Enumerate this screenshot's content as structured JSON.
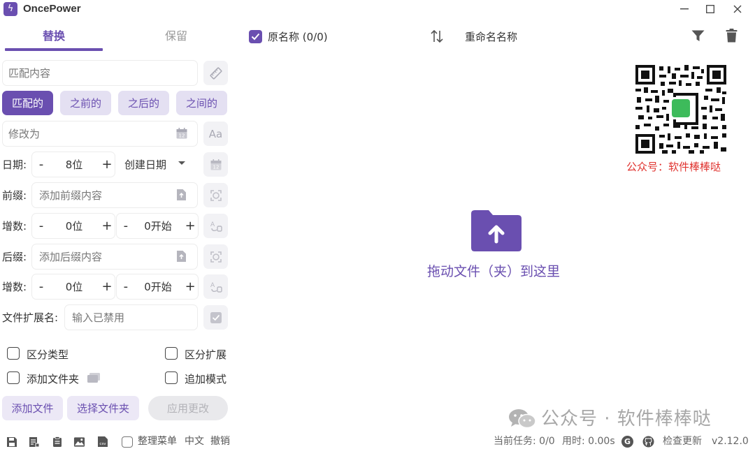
{
  "app": {
    "title": "OncePower",
    "logo_glyph": "ϟ"
  },
  "window_controls": {
    "minimize": "–",
    "maximize": "□",
    "close": "✕"
  },
  "tabs": [
    {
      "label": "替换",
      "active": true
    },
    {
      "label": "保留",
      "active": false
    }
  ],
  "match": {
    "placeholder": "匹配内容"
  },
  "modes": [
    {
      "label": "匹配的",
      "active": true
    },
    {
      "label": "之前的",
      "active": false
    },
    {
      "label": "之后的",
      "active": false
    },
    {
      "label": "之间的",
      "active": false
    }
  ],
  "modify": {
    "placeholder": "修改为",
    "case_button": "Aa"
  },
  "date": {
    "label": "日期:",
    "minus": "-",
    "plus": "+",
    "digits": "8位",
    "type": "创建日期"
  },
  "prefix": {
    "label": "前缀:",
    "placeholder": "添加前缀内容",
    "increment_label": "增数:",
    "digits": "0位",
    "start": "0开始",
    "minus": "-",
    "plus": "+"
  },
  "suffix": {
    "label": "后缀:",
    "placeholder": "添加后缀内容",
    "increment_label": "增数:",
    "digits": "0位",
    "start": "0开始",
    "minus": "-",
    "plus": "+"
  },
  "extension": {
    "label": "文件扩展名:",
    "placeholder": "输入已禁用"
  },
  "options": [
    {
      "label": "区分类型",
      "checked": false
    },
    {
      "label": "区分扩展",
      "checked": false
    },
    {
      "label": "添加文件夹",
      "checked": false
    },
    {
      "label": "追加模式",
      "checked": false
    }
  ],
  "buttons": {
    "add_file": "添加文件",
    "select_folder": "选择文件夹",
    "apply": "应用更改"
  },
  "list_header": {
    "original_name": "原名称 (0/0)",
    "original_checked": true,
    "renamed_name": "重命名名称"
  },
  "qr": {
    "caption": "公众号：软件棒棒哒"
  },
  "drop": {
    "text": "拖动文件（夹）到这里"
  },
  "watermark": {
    "text": "公众号 · 软件棒棒哒"
  },
  "status_bar": {
    "organize_menu": "整理菜单",
    "language": "中文",
    "undo": "撤销",
    "current_task": "当前任务: 0/0",
    "time_used": "用时: 0.00s",
    "g_badge": "G",
    "check_update": "检查更新",
    "version": "v2.12.0"
  },
  "colors": {
    "accent": "#6a4fb0",
    "accent_light": "#e4e0f2",
    "qr_caption": "#e0332f",
    "watermark": "#a7a7a7"
  }
}
